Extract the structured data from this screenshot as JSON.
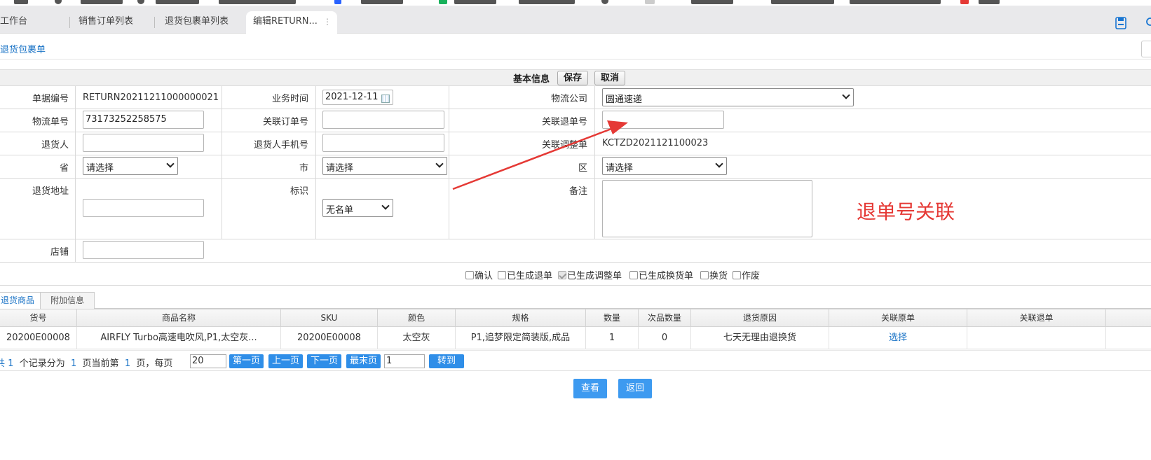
{
  "tabs": [
    {
      "label": "工作台"
    },
    {
      "label": "销售订单列表"
    },
    {
      "label": "退货包裹单列表"
    },
    {
      "label": "编辑RETURN..."
    }
  ],
  "breadcrumb": "退货包裹单",
  "form": {
    "header_title": "基本信息",
    "save_label": "保存",
    "cancel_label": "取消",
    "fields": {
      "doc_no_label": "单据编号",
      "doc_no_value": "RETURN20211211000000021",
      "biz_time_label": "业务时间",
      "biz_time_value": "2021-12-11",
      "logistics_company_label": "物流公司",
      "logistics_company_value": "圆通速递",
      "tracking_no_label": "物流单号",
      "tracking_no_value": "73173252258575",
      "related_order_label": "关联订单号",
      "related_order_value": "",
      "related_return_label": "关联退单号",
      "related_return_value": "",
      "returner_label": "退货人",
      "returner_value": "",
      "returner_phone_label": "退货人手机号",
      "returner_phone_value": "",
      "related_adjust_label": "关联调整单",
      "related_adjust_value": "KCTZD2021121100023",
      "province_label": "省",
      "province_value": "请选择",
      "city_label": "市",
      "city_value": "请选择",
      "district_label": "区",
      "district_value": "请选择",
      "address_label": "退货地址",
      "address_value": "",
      "mark_label": "标识",
      "mark_value": "无名单",
      "remark_label": "备注",
      "remark_value": "",
      "shop_label": "店铺",
      "shop_value": ""
    },
    "checkboxes": [
      {
        "label": "确认",
        "checked": false
      },
      {
        "label": "已生成退单",
        "checked": false
      },
      {
        "label": "已生成调整单",
        "checked": true
      },
      {
        "label": "已生成换货单",
        "checked": false
      },
      {
        "label": "换货",
        "checked": false
      },
      {
        "label": "作废",
        "checked": false
      }
    ]
  },
  "subtabs": [
    {
      "label": "退货商品"
    },
    {
      "label": "附加信息"
    }
  ],
  "grid": {
    "columns": [
      "货号",
      "商品名称",
      "SKU",
      "颜色",
      "规格",
      "数量",
      "次品数量",
      "退货原因",
      "关联原单",
      "关联退单"
    ],
    "rows": [
      [
        "20200E00008",
        "AIRFLY Turbo高速电吹风,P1,太空灰...",
        "20200E00008",
        "太空灰",
        "P1,追梦限定简装版,成品",
        "1",
        "0",
        "七天无理由退换货",
        "选择",
        ""
      ]
    ]
  },
  "pager": {
    "total_prefix": "共",
    "total_count": "1",
    "text_records": "个记录分为",
    "pages": "1",
    "text_pages_current": "页当前第",
    "current": "1",
    "text_per_page": "页，每页",
    "page_size": "20",
    "first": "第一页",
    "prev": "上一页",
    "next": "下一页",
    "last": "最末页",
    "goto_value": "1",
    "goto": "转到"
  },
  "actions": {
    "view": "查看",
    "back": "返回"
  },
  "annotation_text": "退单号关联",
  "colors": {
    "link": "#1a73c6",
    "button_blue": "#3d9af0",
    "annotation_red": "#e53935"
  }
}
